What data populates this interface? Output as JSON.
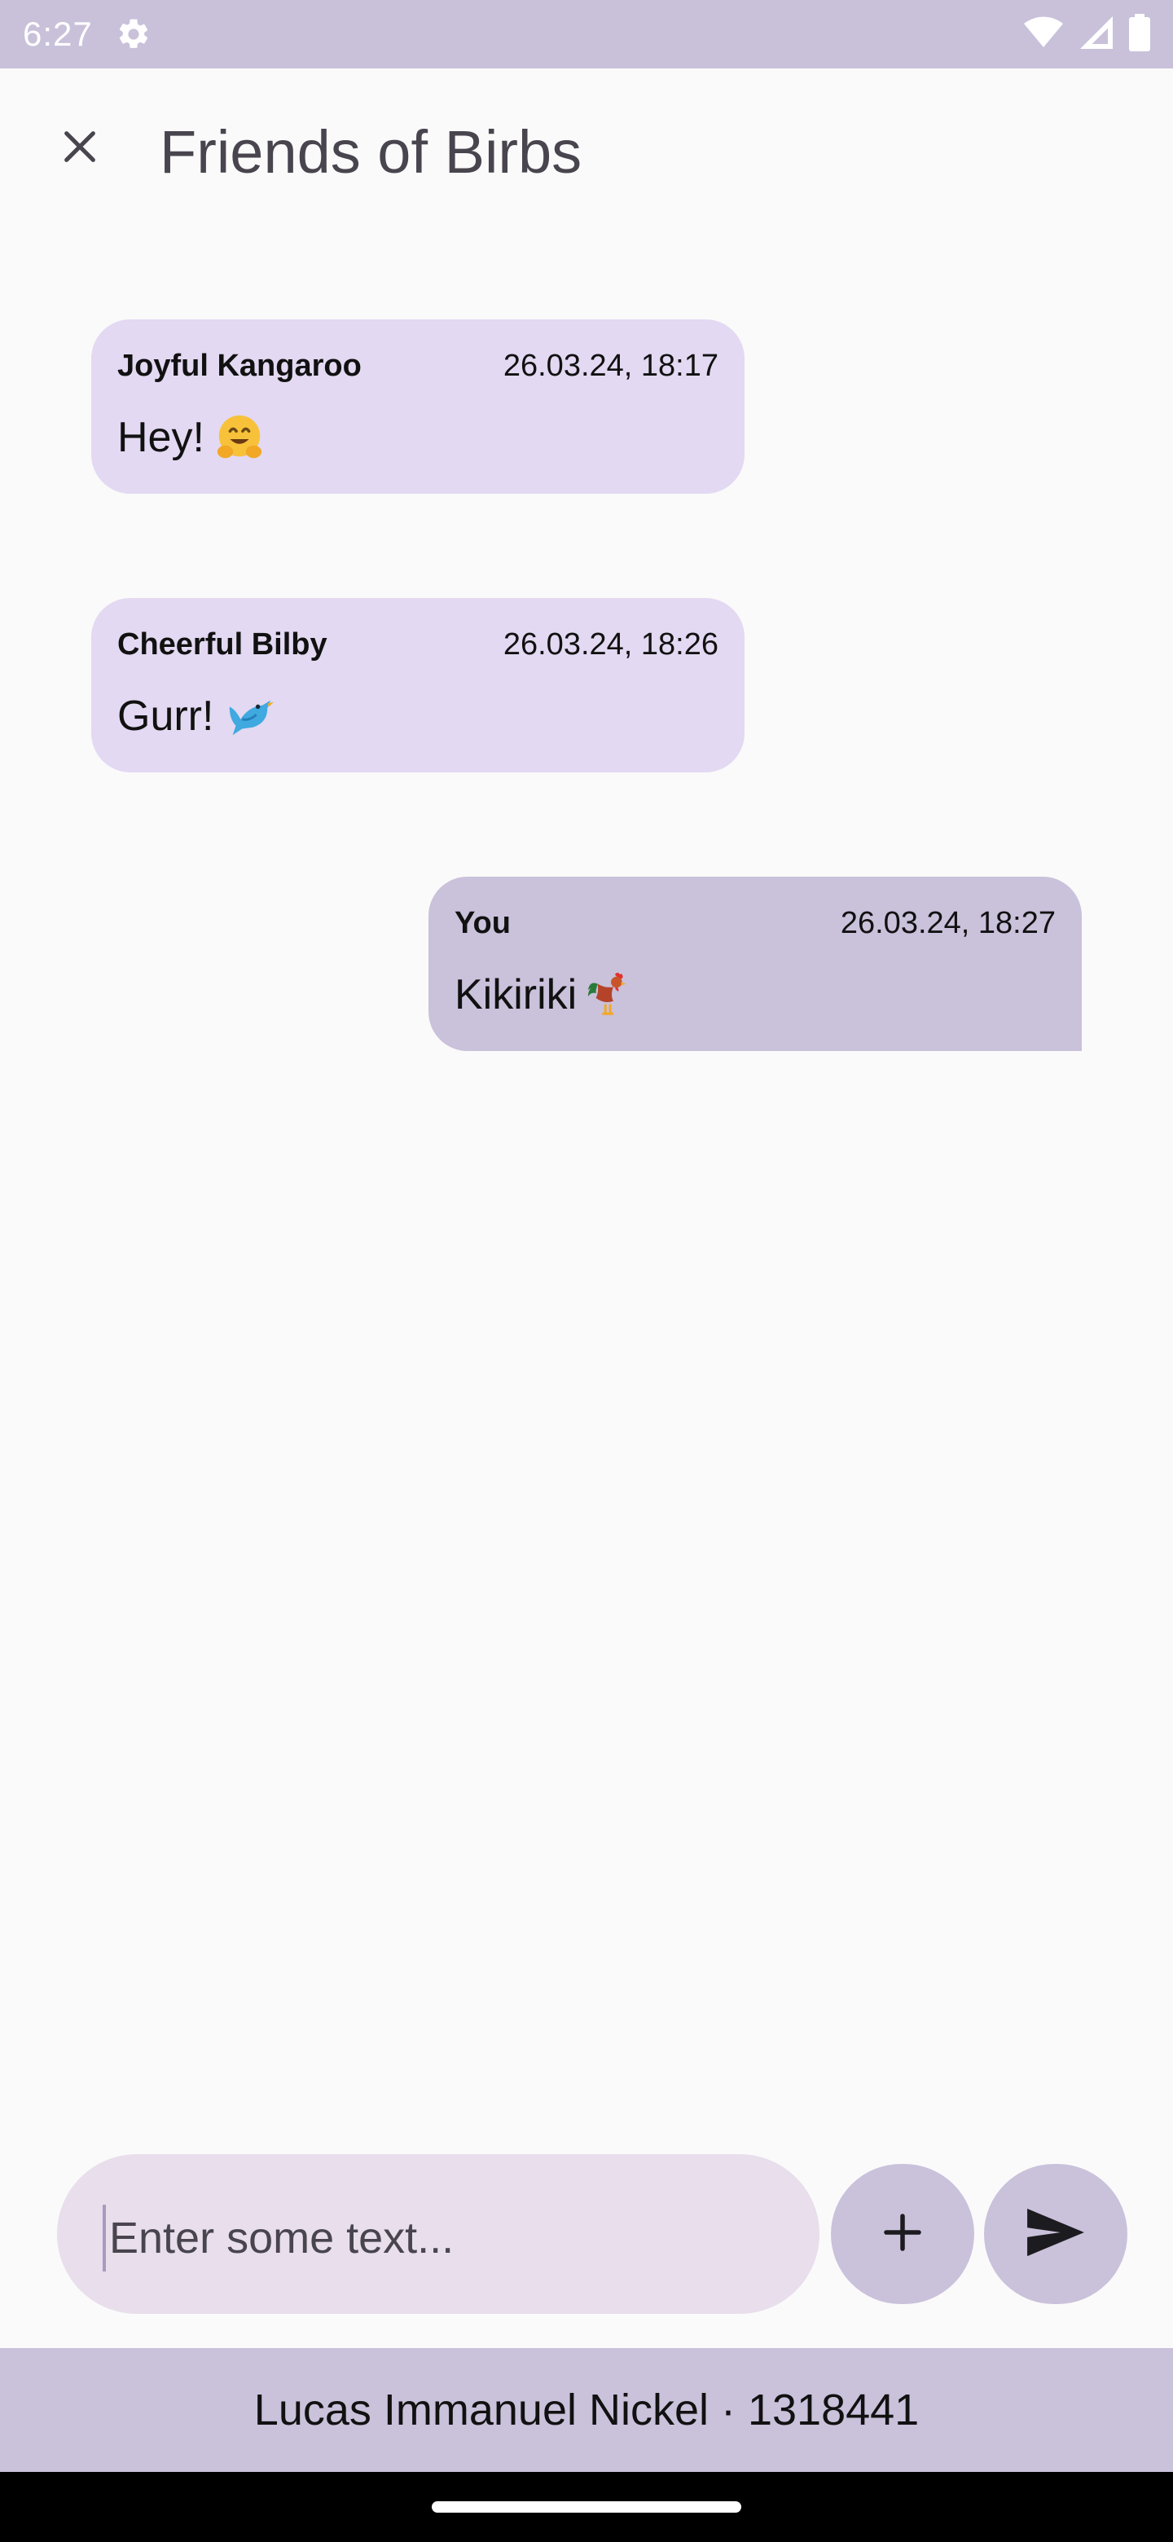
{
  "status_bar": {
    "time": "6:27",
    "icons": [
      "gear-icon",
      "wifi-icon",
      "signal-icon",
      "battery-icon"
    ]
  },
  "app_bar": {
    "close_icon": "close-icon",
    "title": "Friends of Birbs"
  },
  "messages": [
    {
      "sender": "Joyful Kangaroo",
      "time": "26.03.24, 18:17",
      "text": "Hey!",
      "emoji": "hugging-face-emoji",
      "own": false
    },
    {
      "sender": "Cheerful Bilby",
      "time": "26.03.24, 18:26",
      "text": "Gurr!",
      "emoji": "bird-emoji",
      "own": false
    },
    {
      "sender": "You",
      "time": "26.03.24, 18:27",
      "text": "Kikiriki",
      "emoji": "rooster-emoji",
      "own": true
    }
  ],
  "composer": {
    "placeholder": "Enter some text...",
    "add_icon": "plus-icon",
    "send_icon": "send-icon"
  },
  "footer": {
    "text": "Lucas Immanuel Nickel · 1318441"
  },
  "colors": {
    "status_bar": "#c9c1da",
    "background": "#fafafa",
    "incoming_bubble": "#e3d9f2",
    "outgoing_bubble": "#cac1db",
    "input": "#e8deec",
    "buttons": "#cac1db",
    "footer": "#cac1db"
  }
}
